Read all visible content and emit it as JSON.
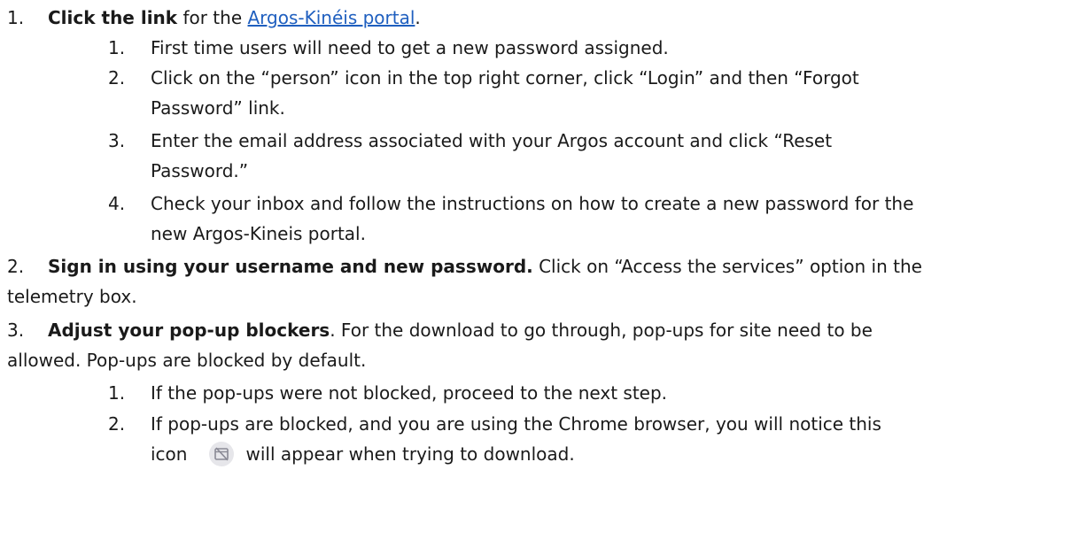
{
  "steps": [
    {
      "number": "1.",
      "bold": "Click the link",
      "text_before_link": " for the ",
      "link_text": "Argos-Kinéis portal",
      "text_after_link": ".",
      "substeps": [
        {
          "number": "1.",
          "lines": [
            "First time users will need to get a new password assigned."
          ]
        },
        {
          "number": "2.",
          "lines": [
            "Click on the “person” icon in the top right corner, click “Login” and then “Forgot",
            "Password” link."
          ]
        },
        {
          "number": "3.",
          "lines": [
            "Enter the email address associated with your Argos account and click “Reset",
            "Password.”"
          ]
        },
        {
          "number": "4.",
          "lines": [
            "Check your inbox and follow the instructions on how to create a new password for the",
            "new Argos-Kineis portal."
          ]
        }
      ]
    },
    {
      "number": "2.",
      "bold": "Sign in using your username and new password.",
      "lines": [
        " Click on “Access the services” option in the",
        "telemetry box."
      ]
    },
    {
      "number": "3.",
      "bold": "Adjust your pop-up blockers",
      "lines": [
        ". For the download to go through, pop-ups for site need to be",
        "allowed. Pop-ups are blocked by default."
      ],
      "substeps": [
        {
          "number": "1.",
          "lines": [
            "If the pop-ups were not blocked, proceed to the next step."
          ]
        },
        {
          "number": "2.",
          "lines": [
            "If pop-ups are blocked, and you are using the Chrome browser, you will notice this"
          ],
          "icon_line_before": "icon",
          "icon_name": "popup-blocked-icon",
          "icon_line_after": "will appear when trying to download."
        }
      ]
    }
  ]
}
